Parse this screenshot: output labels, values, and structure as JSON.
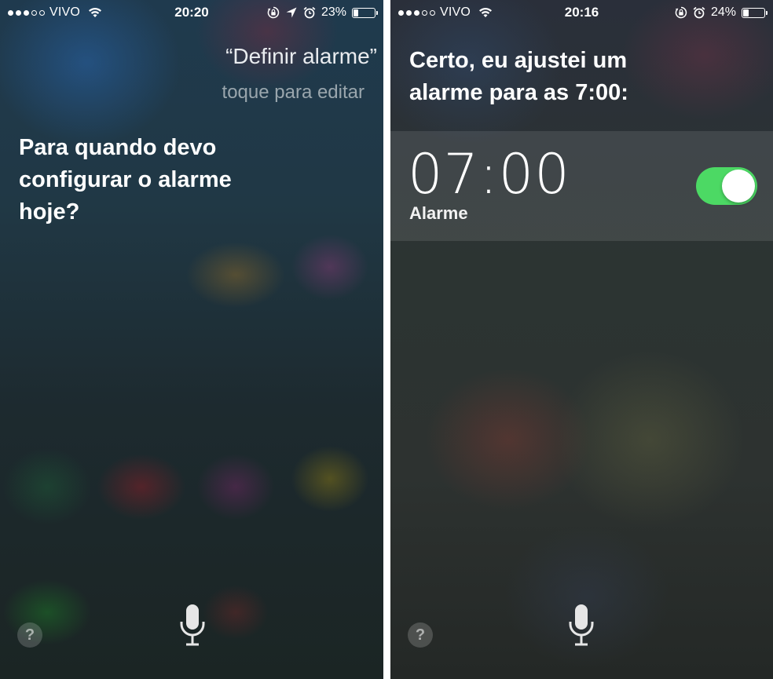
{
  "screens": [
    {
      "status": {
        "carrier": "VIVO",
        "signal_filled": 3,
        "signal_empty": 2,
        "time": "20:20",
        "battery": "23%",
        "battery_level": 23,
        "icons": [
          "wifi-icon",
          "orientation-lock-icon",
          "location-arrow-icon",
          "alarm-clock-icon"
        ]
      },
      "query": "“Definir alarme”",
      "edit_hint": "toque para editar",
      "response": "Para quando devo configurar o alarme hoje?",
      "help": "?",
      "mic_icon": "microphone-icon"
    },
    {
      "status": {
        "carrier": "VIVO",
        "signal_filled": 3,
        "signal_empty": 2,
        "time": "20:16",
        "battery": "24%",
        "battery_level": 24,
        "icons": [
          "wifi-icon",
          "orientation-lock-icon",
          "alarm-clock-icon"
        ]
      },
      "response": "Certo, eu ajustei um alarme para as 7:00:",
      "alarm": {
        "time": "07:00",
        "label": "Alarme",
        "enabled": true,
        "toggle_color": "#4cd964"
      },
      "help": "?",
      "mic_icon": "microphone-icon"
    }
  ]
}
